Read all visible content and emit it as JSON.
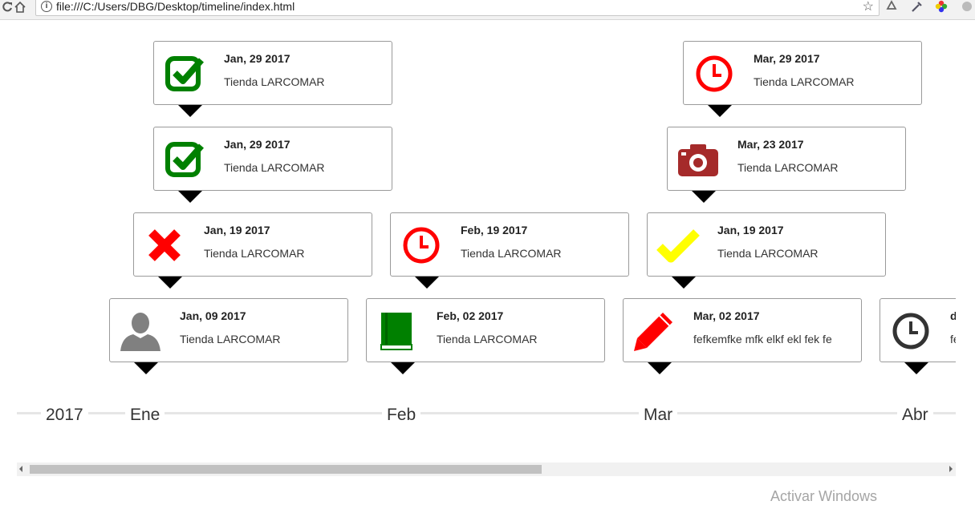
{
  "browser": {
    "url": "file:///C:/Users/DBG/Desktop/timeline/index.html"
  },
  "timeline": {
    "year": "2017",
    "months": [
      "Ene",
      "Feb",
      "Mar",
      "Abr"
    ],
    "events": [
      {
        "date": "Jan, 29 2017",
        "desc": "Tienda LARCOMAR",
        "icon": "checkbox-check-icon",
        "color": "#008000"
      },
      {
        "date": "Jan, 29 2017",
        "desc": "Tienda LARCOMAR",
        "icon": "checkbox-check-icon",
        "color": "#008000"
      },
      {
        "date": "Jan, 19 2017",
        "desc": "Tienda LARCOMAR",
        "icon": "cross-icon",
        "color": "#ff0000"
      },
      {
        "date": "Jan, 09 2017",
        "desc": "Tienda LARCOMAR",
        "icon": "user-icon",
        "color": "#808080"
      },
      {
        "date": "Feb, 19 2017",
        "desc": "Tienda LARCOMAR",
        "icon": "clock-icon",
        "color": "#ff0000"
      },
      {
        "date": "Feb, 02 2017",
        "desc": "Tienda LARCOMAR",
        "icon": "book-icon",
        "color": "#008000"
      },
      {
        "date": "Mar, 29 2017",
        "desc": "Tienda LARCOMAR",
        "icon": "clock-icon",
        "color": "#ff0000"
      },
      {
        "date": "Mar, 23 2017",
        "desc": "Tienda LARCOMAR",
        "icon": "camera-icon",
        "color": "#a52a2a"
      },
      {
        "date": "Jan, 19 2017",
        "desc": "Tienda LARCOMAR",
        "icon": "check-icon",
        "color": "#ffff00"
      },
      {
        "date": "Mar, 02 2017",
        "desc": "fefkemfke mfk elkf ekl fek fe",
        "icon": "pencil-icon",
        "color": "#ff0000"
      },
      {
        "date": "d",
        "desc": "fe",
        "icon": "clock-icon",
        "color": "#333333"
      }
    ]
  },
  "watermark": "Activar Windows"
}
